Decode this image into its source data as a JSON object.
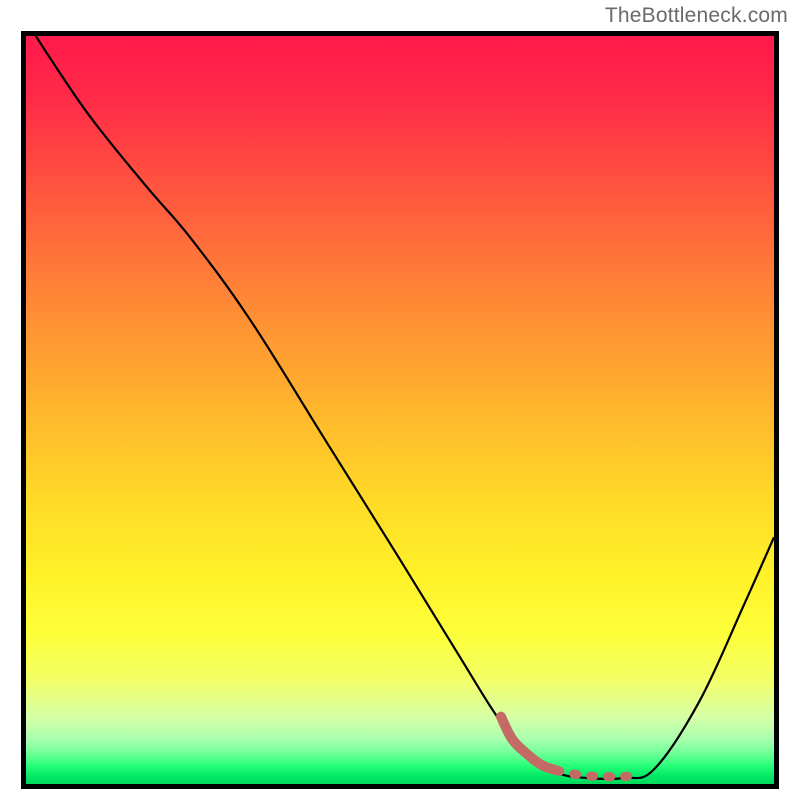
{
  "watermark": "TheBottleneck.com",
  "chart_data": {
    "type": "line",
    "title": "",
    "xlabel": "",
    "ylabel": "",
    "xlim": [
      0,
      100
    ],
    "ylim": [
      0,
      100
    ],
    "grid": false,
    "annotations": [],
    "gradient_stops": [
      {
        "pct": 0,
        "color": "#ff1a4b"
      },
      {
        "pct": 22,
        "color": "#ff5a3e"
      },
      {
        "pct": 50,
        "color": "#ffb62c"
      },
      {
        "pct": 72,
        "color": "#fff128"
      },
      {
        "pct": 91,
        "color": "#d7ffa6"
      },
      {
        "pct": 99,
        "color": "#00e865"
      },
      {
        "pct": 100,
        "color": "#00d85c"
      }
    ],
    "series": [
      {
        "name": "main-curve",
        "color": "#000000",
        "stroke_width": 2,
        "points": [
          {
            "x": 0,
            "y": 102
          },
          {
            "x": 8,
            "y": 90
          },
          {
            "x": 16,
            "y": 80
          },
          {
            "x": 22,
            "y": 73
          },
          {
            "x": 30,
            "y": 62
          },
          {
            "x": 40,
            "y": 46
          },
          {
            "x": 50,
            "y": 30
          },
          {
            "x": 58,
            "y": 17
          },
          {
            "x": 63,
            "y": 9
          },
          {
            "x": 67,
            "y": 4
          },
          {
            "x": 71,
            "y": 1.5
          },
          {
            "x": 75,
            "y": 0.8
          },
          {
            "x": 80,
            "y": 0.8
          },
          {
            "x": 84,
            "y": 2
          },
          {
            "x": 90,
            "y": 11
          },
          {
            "x": 96,
            "y": 24
          },
          {
            "x": 100,
            "y": 33
          }
        ]
      },
      {
        "name": "highlight-segment",
        "color": "#c96a62",
        "stroke_width": 8,
        "dash": "8 5",
        "points": [
          {
            "x": 63.5,
            "y": 9
          },
          {
            "x": 65,
            "y": 6
          },
          {
            "x": 67,
            "y": 4
          },
          {
            "x": 69,
            "y": 2.5
          },
          {
            "x": 71,
            "y": 1.8
          },
          {
            "x": 74,
            "y": 1.2
          },
          {
            "x": 77,
            "y": 1.0
          },
          {
            "x": 80,
            "y": 1.0
          },
          {
            "x": 82,
            "y": 1.3
          }
        ]
      }
    ]
  }
}
